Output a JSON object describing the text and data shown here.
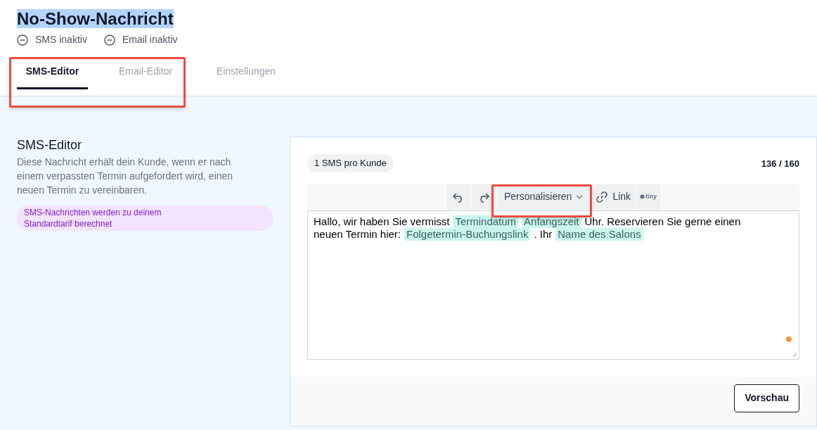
{
  "header": {
    "title": "No-Show-Nachricht",
    "title_selected": true,
    "statuses": [
      {
        "label": "SMS inaktiv"
      },
      {
        "label": "Email inaktiv"
      }
    ]
  },
  "tabs": [
    {
      "label": "SMS-Editor",
      "selected": true
    },
    {
      "label": "Email-Editor",
      "selected": false
    },
    {
      "label": "Einstellungen",
      "selected": false
    }
  ],
  "intro": {
    "heading": "SMS-Editor",
    "description": "Diese Nachricht erhält dein Kunde, wenn er nach einem verpassten Termin aufgefordert wird, einen neuen Termin zu vereinbaren.",
    "notice": "SMS-Nachrichten werden zu deinem Standardtarif berechnet"
  },
  "editor": {
    "sms_badge": "1 SMS pro Kunde",
    "char_count": "136 / 160",
    "toolbar": {
      "personalize": "Personalisieren",
      "link": "Link",
      "brand": "tiny"
    },
    "lines": [
      [
        {
          "kind": "text",
          "text": "Hallo, wir haben Sie vermisst"
        },
        {
          "kind": "token",
          "text": "Termindatum"
        },
        {
          "kind": "token",
          "text": "Anfangszeit"
        },
        {
          "kind": "text",
          "text": "Uhr. Reservieren Sie gerne einen"
        }
      ],
      [
        {
          "kind": "text",
          "text": "neuen Termin hier:"
        },
        {
          "kind": "token",
          "text": "Folgetermin-Buchungslink"
        },
        {
          "kind": "text",
          "text": ". Ihr"
        },
        {
          "kind": "token",
          "text": "Name des Salons"
        }
      ]
    ],
    "preview_button": "Vorschau"
  }
}
